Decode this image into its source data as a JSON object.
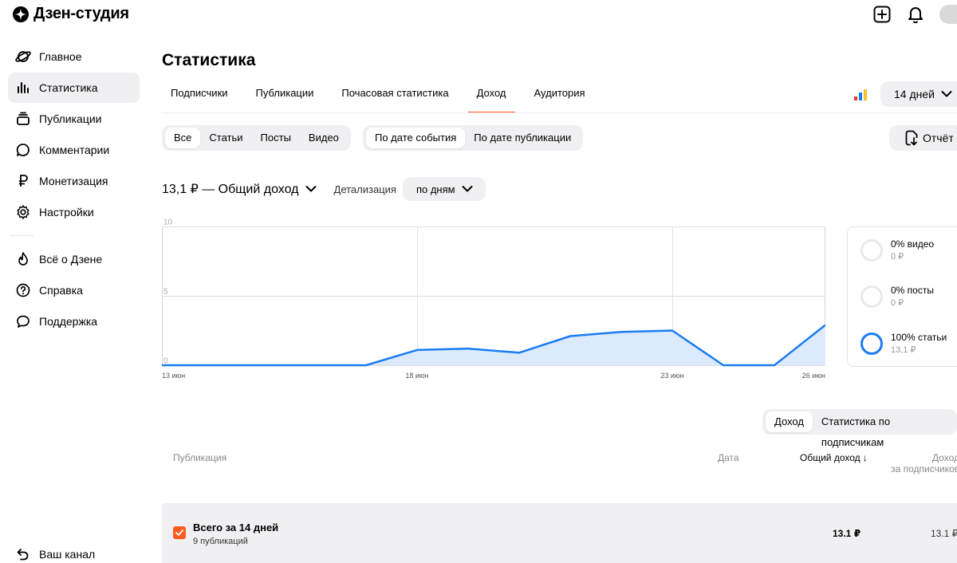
{
  "app": {
    "title": "Дзен-студия"
  },
  "sidebar": {
    "items": [
      {
        "label": "Главное",
        "icon": "planet-icon"
      },
      {
        "label": "Статистика",
        "icon": "bar-chart-icon",
        "active": true
      },
      {
        "label": "Публикации",
        "icon": "stack-icon"
      },
      {
        "label": "Комментарии",
        "icon": "comment-icon"
      },
      {
        "label": "Монетизация",
        "icon": "ruble-icon"
      },
      {
        "label": "Настройки",
        "icon": "gear-icon"
      }
    ],
    "extra": [
      {
        "label": "Всё о Дзене",
        "icon": "flame-icon"
      },
      {
        "label": "Справка",
        "icon": "question-icon"
      },
      {
        "label": "Поддержка",
        "icon": "chat-icon"
      }
    ],
    "bottom": {
      "label": "Ваш канал",
      "icon": "back-arrow-icon"
    }
  },
  "page": {
    "title": "Статистика"
  },
  "tabs": [
    "Подписчики",
    "Публикации",
    "Почасовая статистика",
    "Доход",
    "Аудитория"
  ],
  "active_tab": "Доход",
  "period": {
    "label": "14 дней"
  },
  "filters": {
    "types": [
      "Все",
      "Статьи",
      "Посты",
      "Видео"
    ],
    "active_type": "Все",
    "date_modes": [
      "По дате события",
      "По дате публикации"
    ],
    "active_date_mode": "По дате события"
  },
  "report": {
    "label": "Отчёт"
  },
  "summary": {
    "total_label": "13,1 ₽ — Общий доход",
    "detail_label": "Детализация",
    "detail_value": "по дням"
  },
  "chart_data": {
    "type": "area",
    "x": [
      "13 июн",
      "14 июн",
      "15 июн",
      "16 июн",
      "17 июн",
      "18 июн",
      "19 июн",
      "20 июн",
      "21 июн",
      "22 июн",
      "23 июн",
      "24 июн",
      "25 июн",
      "26 июн"
    ],
    "x_tick_labels": [
      "13 июн",
      "18 июн",
      "23 июн",
      "26 июн"
    ],
    "series": [
      {
        "values": [
          0,
          0,
          0,
          0,
          0,
          1.1,
          1.2,
          0.9,
          2.1,
          2.4,
          2.5,
          0,
          0,
          2.9
        ]
      }
    ],
    "y_ticks": [
      "0",
      "5",
      "10"
    ],
    "ylim": [
      0,
      10
    ],
    "grid": true,
    "color": "#1a7cf5",
    "fill": "#dbeafc"
  },
  "shares": [
    {
      "pct": "0% видео",
      "amount": "0 ₽",
      "full": false
    },
    {
      "pct": "0% посты",
      "amount": "0 ₽",
      "full": false
    },
    {
      "pct": "100% статьи",
      "amount": "13,1 ₽",
      "full": true
    }
  ],
  "table_tabs": [
    "Доход",
    "Статистика по подписчикам"
  ],
  "active_table_tab": "Доход",
  "columns": {
    "publication": "Публикация",
    "date": "Дата",
    "total_income": "Общий доход",
    "sort_arrow": "↓",
    "subscriber_income_line1": "Доход",
    "subscriber_income_line2": "за подписчиков"
  },
  "total_row": {
    "title": "Всего за 14 дней",
    "subtitle": "9 публикаций",
    "total": "13.1 ₽",
    "subscribers": "13.1 ₽"
  },
  "colors": {
    "accent": "#ff5a1f",
    "line": "#1a7cf5",
    "muted": "#f0f0f2"
  }
}
